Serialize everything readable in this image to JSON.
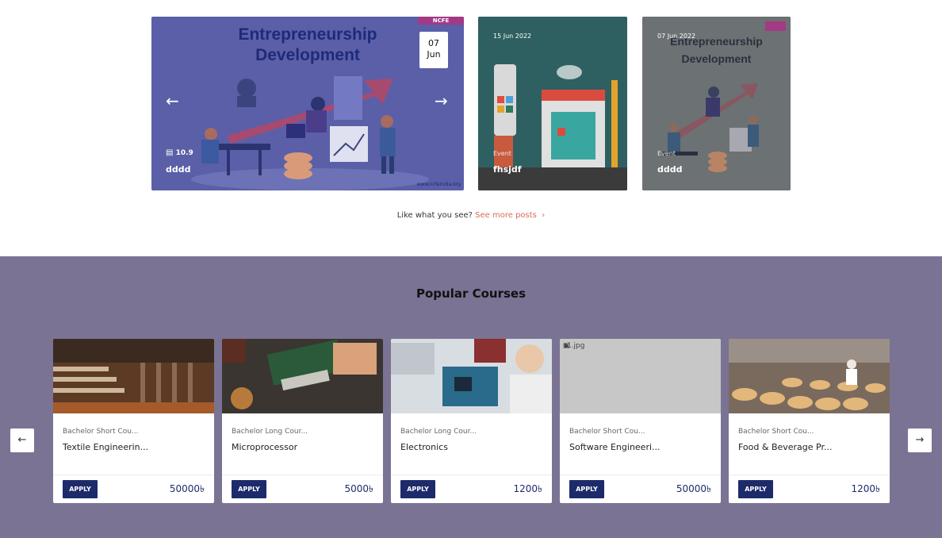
{
  "slider": {
    "main": {
      "illustration_title_line1": "Entrepreneurship",
      "illustration_title_line2": "Development",
      "logo_text": "NCFE",
      "watermark": "www.ncfeindia.org",
      "date_day": "07",
      "date_month": "Jun",
      "stat_value": "10.9",
      "caption": "dddd"
    },
    "card_b": {
      "date": "15 Jun 2022",
      "tag": "Event",
      "title": "fhsjdf"
    },
    "card_c": {
      "date": "07 Jun 2022",
      "illustration_title_line1": "Entrepreneurship",
      "illustration_title_line2": "Development",
      "tag": "Event",
      "title": "dddd"
    }
  },
  "more_posts": {
    "prefix": "Like what you see?",
    "link": "See more posts"
  },
  "courses": {
    "heading": "Popular Courses",
    "items": [
      {
        "category": "Bachelor Short Cou...",
        "name": "Textile Engineerin...",
        "apply": "APPLY",
        "price": "50000৳"
      },
      {
        "category": "Bachelor Long Cour...",
        "name": "Microprocessor",
        "apply": "APPLY",
        "price": "5000৳"
      },
      {
        "category": "Bachelor Long Cour...",
        "name": "Electronics",
        "apply": "APPLY",
        "price": "1200৳"
      },
      {
        "category": "Bachelor Short Cou...",
        "name": "Software Engineeri...",
        "apply": "APPLY",
        "price": "50000৳",
        "image_alt": "c1.jpg"
      },
      {
        "category": "Bachelor Short Cou...",
        "name": "Food & Beverage Pr...",
        "apply": "APPLY",
        "price": "1200৳"
      }
    ]
  }
}
